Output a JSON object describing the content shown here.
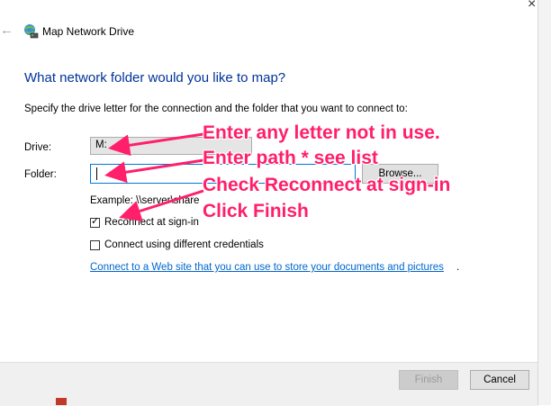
{
  "window": {
    "title": "Map Network Drive",
    "close_glyph": "×",
    "back_glyph": "←"
  },
  "page": {
    "heading": "What network folder would you like to map?",
    "description": "Specify the drive letter for the connection and the folder that you want to connect to:"
  },
  "form": {
    "drive_label": "Drive:",
    "drive_value": "M:",
    "folder_label": "Folder:",
    "folder_value": "",
    "browse_label": "Browse...",
    "example_text": "Example: \\\\server\\share",
    "reconnect_label": "Reconnect at sign-in",
    "reconnect_checked": true,
    "credentials_label": "Connect using different credentials",
    "credentials_checked": false,
    "link_text": "Connect to a Web site that you can use to store your documents and pictures",
    "link_suffix": "."
  },
  "footer": {
    "finish_label": "Finish",
    "cancel_label": "Cancel"
  },
  "annotations": {
    "line1": "Enter any letter not in use.",
    "line2": "Enter path * see list",
    "line3": "Check Reconnect at sign-in",
    "line4": "Click Finish",
    "color": "#ff1f6a"
  },
  "icons": {
    "app_icon": "network-drive-icon",
    "check_mark": "✓"
  }
}
